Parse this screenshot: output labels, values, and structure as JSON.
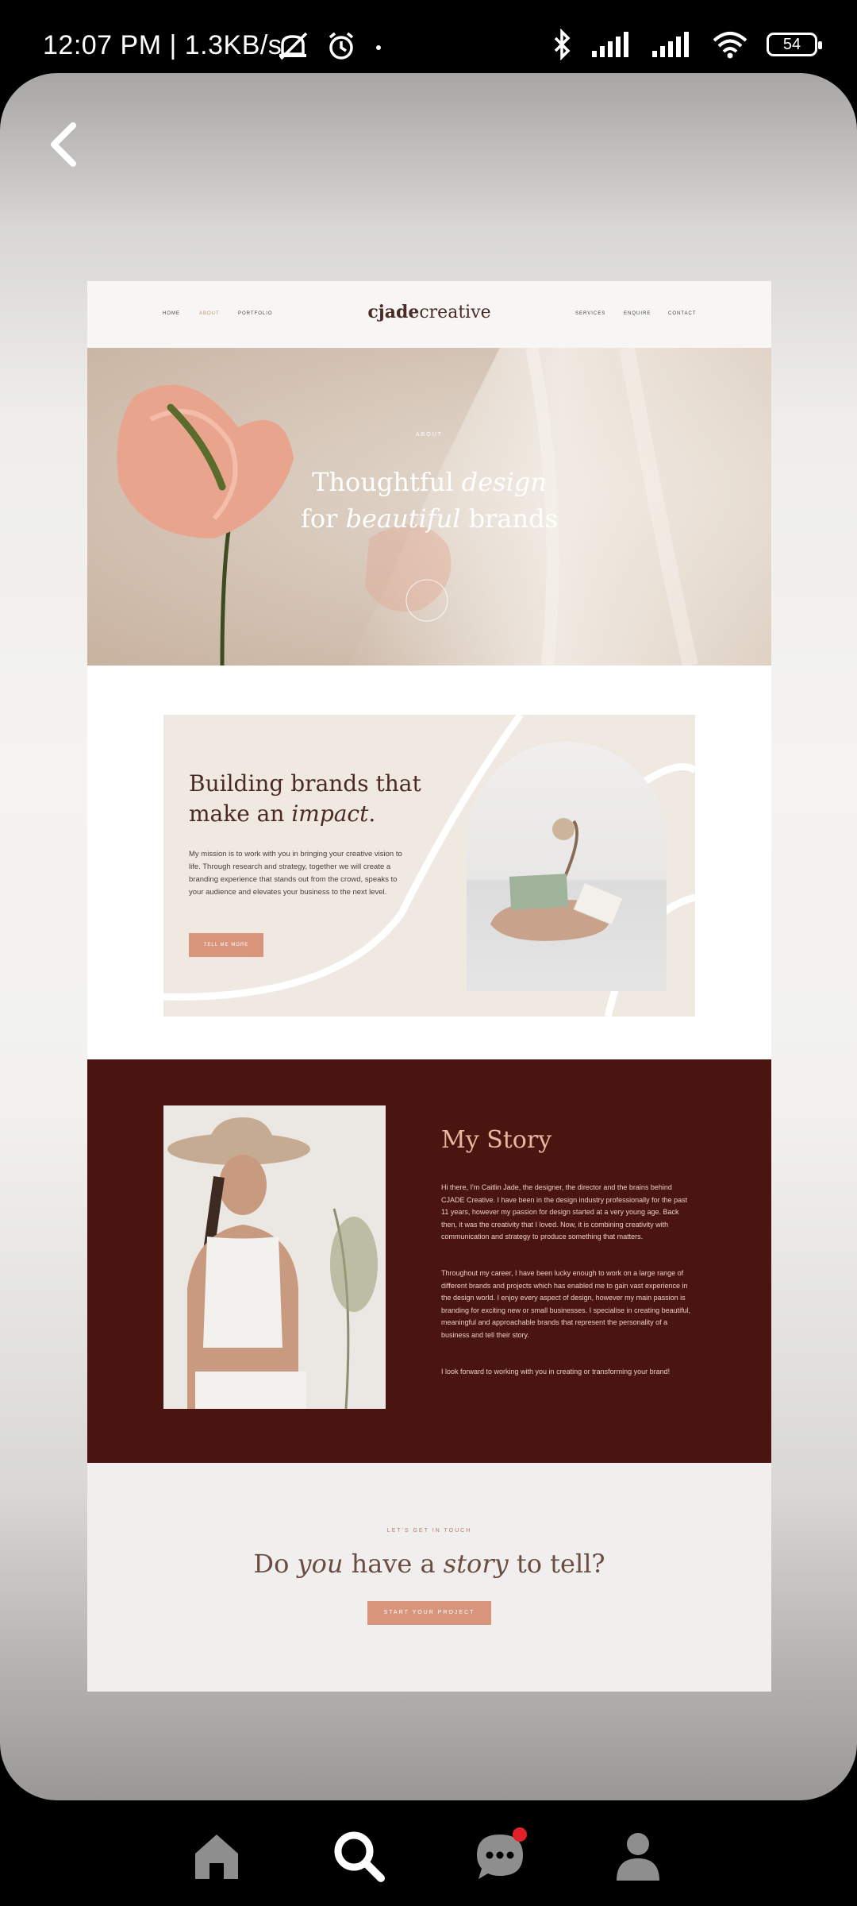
{
  "status_bar": {
    "time": "12:07 PM | 1.3KB/s",
    "battery": "54"
  },
  "site": {
    "nav": {
      "left": [
        "HOME",
        "ABOUT",
        "PORTFOLIO"
      ],
      "right": [
        "SERVICES",
        "ENQUIRE",
        "CONTACT"
      ],
      "logo_bold": "cjade",
      "logo_light": "creative"
    },
    "hero": {
      "eyebrow": "ABOUT",
      "line1_plain": "Thoughtful ",
      "line1_italic": "design",
      "line2_plain_a": "for ",
      "line2_italic": "beautiful",
      "line2_plain_b": " brands"
    },
    "impact": {
      "title_line1": "Building brands that",
      "title_line2_plain": "make an ",
      "title_line2_italic": "impact",
      "title_line2_end": ".",
      "body": "My mission is to work with you in bringing your creative vision to life. Through research and strategy, together we will create a branding experience that stands out from the crowd, speaks to your audience and elevates your business to the next level.",
      "button": "TELL ME MORE"
    },
    "story": {
      "title": "My Story",
      "p1": "Hi there, I'm Caitlin Jade, the designer, the director and the brains behind CJADE Creative. I have been in the design industry professionally for the past 11 years, however my passion for design started at a very young age. Back then, it was the creativity that I loved. Now, it is combining creativity with communication and strategy to produce something that matters.",
      "p2": "Throughout my career, I have been lucky enough to work on a large range of different brands and projects which has enabled me to gain vast experience in the design world. I enjoy every aspect of design, however my main passion is branding for exciting new or small businesses. I specialise in creating beautiful, meaningful and approachable brands that represent the personality of a business and tell their story.",
      "p3": "I look forward to working with you in creating or transforming your brand!"
    },
    "cta": {
      "eyebrow": "LET'S GET IN TOUCH",
      "t1": "Do ",
      "t2": "you",
      "t3": " have a ",
      "t4": "story",
      "t5": " to tell?",
      "button": "START YOUR PROJECT"
    }
  },
  "icons": {
    "back": "chevron-left-icon",
    "home": "home-icon",
    "search": "search-icon",
    "messages": "chat-bubble-icon",
    "profile": "person-icon"
  },
  "colors": {
    "accent_red_badge": "#e2202a",
    "story_bg": "#4a1410",
    "button_peach": "#d8957c"
  }
}
